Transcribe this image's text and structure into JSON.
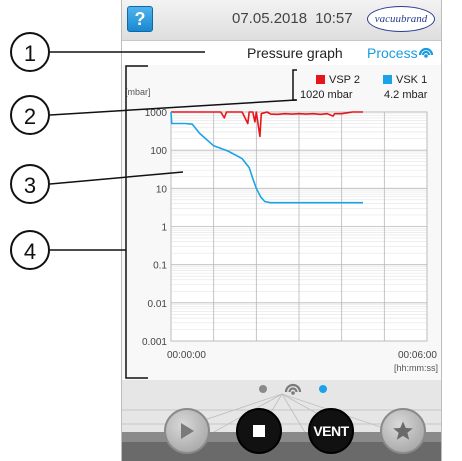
{
  "topbar": {
    "help_icon": "help-icon",
    "help_label": "?",
    "date": "07.05.2018",
    "time": "10:57",
    "logo_text": "vacuubrand"
  },
  "titlebar": {
    "title": "Pressure graph",
    "process_label": "Process",
    "process_icon": "process-signal-icon"
  },
  "legend": [
    {
      "name": "VSP 2",
      "value": "1020 mbar",
      "color": "#e8141c"
    },
    {
      "name": "VSK 1",
      "value": "4.2 mbar",
      "color": "#1aa3e8"
    }
  ],
  "chart_data": {
    "type": "line",
    "ylabel": "[mbar]",
    "xunit": "[hh:mm:ss]",
    "y_scale": "log",
    "ylim": [
      0.001,
      1000
    ],
    "y_ticks": [
      "1000",
      "100",
      "10",
      "1",
      "0.1",
      "0.01",
      "0.001"
    ],
    "x_ticks": [
      "00:00:00",
      "00:06:00"
    ],
    "xlim_seconds": [
      0,
      360
    ],
    "grid": true,
    "series": [
      {
        "name": "VSP 2",
        "color": "#e8141c",
        "points": [
          [
            0,
            1000
          ],
          [
            10,
            1000
          ],
          [
            20,
            1000
          ],
          [
            30,
            1000
          ],
          [
            40,
            1000
          ],
          [
            50,
            1000
          ],
          [
            60,
            1000
          ],
          [
            70,
            1000
          ],
          [
            75,
            700
          ],
          [
            78,
            1000
          ],
          [
            90,
            1000
          ],
          [
            100,
            1000
          ],
          [
            108,
            500
          ],
          [
            110,
            1000
          ],
          [
            115,
            1000
          ],
          [
            118,
            550
          ],
          [
            120,
            1000
          ],
          [
            125,
            230
          ],
          [
            127,
            900
          ],
          [
            135,
            1000
          ],
          [
            140,
            880
          ],
          [
            150,
            870
          ],
          [
            160,
            900
          ],
          [
            170,
            880
          ],
          [
            180,
            900
          ],
          [
            190,
            880
          ],
          [
            200,
            900
          ],
          [
            210,
            870
          ],
          [
            220,
            900
          ],
          [
            228,
            780
          ],
          [
            230,
            900
          ],
          [
            240,
            900
          ],
          [
            255,
            1000
          ],
          [
            270,
            1000
          ]
        ]
      },
      {
        "name": "VSK 1",
        "color": "#1aa3e8",
        "points": [
          [
            0,
            1000
          ],
          [
            1,
            500
          ],
          [
            20,
            500
          ],
          [
            30,
            480
          ],
          [
            40,
            280
          ],
          [
            60,
            130
          ],
          [
            80,
            95
          ],
          [
            100,
            60
          ],
          [
            110,
            35
          ],
          [
            115,
            18
          ],
          [
            120,
            10
          ],
          [
            126,
            6
          ],
          [
            132,
            4.5
          ],
          [
            140,
            4.2
          ],
          [
            180,
            4.2
          ],
          [
            220,
            4.2
          ],
          [
            270,
            4.2
          ]
        ]
      }
    ]
  },
  "pager": {
    "page_count": 3,
    "active_index": 2
  },
  "controls": {
    "play_icon": "play-icon",
    "stop_icon": "stop-icon",
    "vent_label": "VENT",
    "favorite_icon": "star-icon"
  },
  "callouts": [
    "1",
    "2",
    "3",
    "4"
  ]
}
